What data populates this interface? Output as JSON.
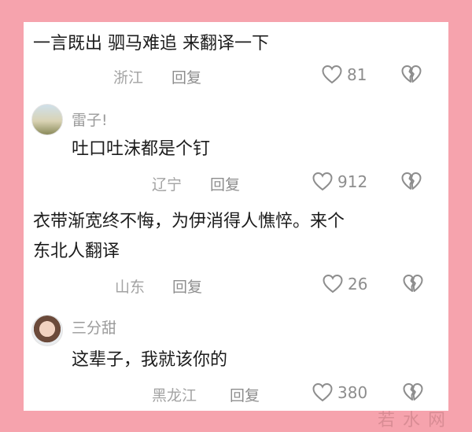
{
  "comments": [
    {
      "text_lines": [
        "一言既出 驷马难追 来翻译一下"
      ],
      "location": "浙江",
      "reply_label": "回复",
      "likes": "81"
    },
    {
      "username": "雷子!",
      "avatar_icon": "landscape-avatar",
      "text_lines": [
        "吐口吐沫都是个钉"
      ],
      "location": "辽宁",
      "reply_label": "回复",
      "likes": "912"
    },
    {
      "text_lines": [
        "衣带渐宽终不悔，为伊消得人憔悴。来个",
        "东北人翻译"
      ],
      "location": "山东",
      "reply_label": "回复",
      "likes": "26"
    },
    {
      "username": "三分甜",
      "avatar_icon": "child-photo-avatar",
      "text_lines": [
        "这辈子，我就该你的"
      ],
      "location": "黑龙江",
      "reply_label": "回复",
      "likes": "380"
    }
  ],
  "icons": {
    "like": "heart-outline-icon",
    "dislike": "broken-heart-icon"
  },
  "colors": {
    "background": "#f6a3ad",
    "panel": "#ffffff",
    "text": "#1c1c1c",
    "meta": "#a3a3a3"
  },
  "watermark": "若水网"
}
